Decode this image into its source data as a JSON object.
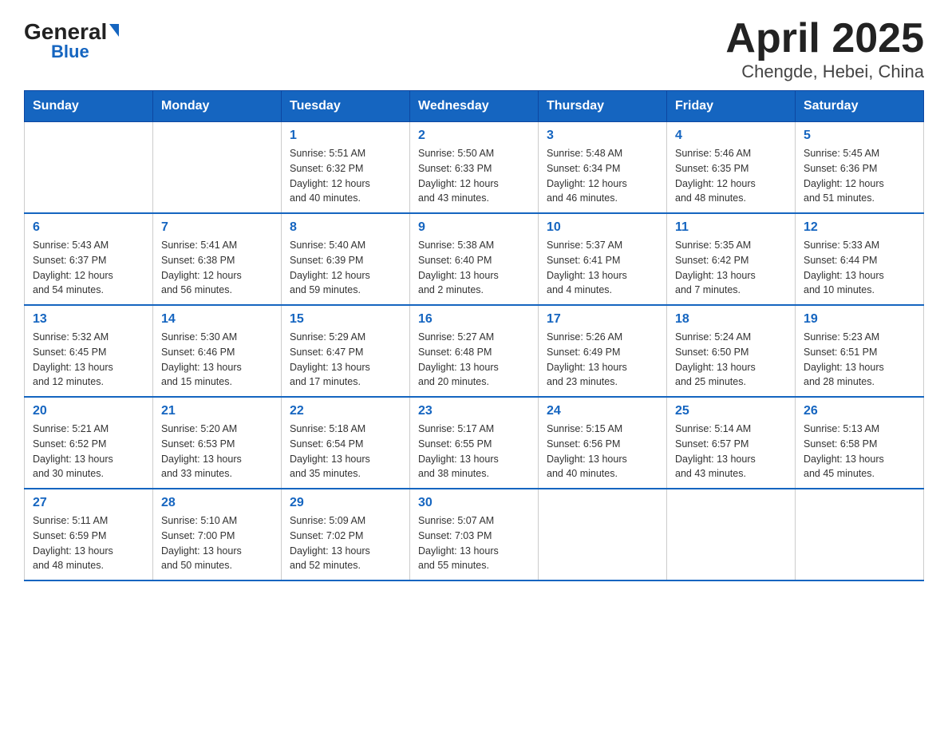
{
  "logo": {
    "general": "General",
    "blue": "Blue"
  },
  "title": "April 2025",
  "subtitle": "Chengde, Hebei, China",
  "days_of_week": [
    "Sunday",
    "Monday",
    "Tuesday",
    "Wednesday",
    "Thursday",
    "Friday",
    "Saturday"
  ],
  "weeks": [
    [
      {
        "day": "",
        "info": ""
      },
      {
        "day": "",
        "info": ""
      },
      {
        "day": "1",
        "info": "Sunrise: 5:51 AM\nSunset: 6:32 PM\nDaylight: 12 hours\nand 40 minutes."
      },
      {
        "day": "2",
        "info": "Sunrise: 5:50 AM\nSunset: 6:33 PM\nDaylight: 12 hours\nand 43 minutes."
      },
      {
        "day": "3",
        "info": "Sunrise: 5:48 AM\nSunset: 6:34 PM\nDaylight: 12 hours\nand 46 minutes."
      },
      {
        "day": "4",
        "info": "Sunrise: 5:46 AM\nSunset: 6:35 PM\nDaylight: 12 hours\nand 48 minutes."
      },
      {
        "day": "5",
        "info": "Sunrise: 5:45 AM\nSunset: 6:36 PM\nDaylight: 12 hours\nand 51 minutes."
      }
    ],
    [
      {
        "day": "6",
        "info": "Sunrise: 5:43 AM\nSunset: 6:37 PM\nDaylight: 12 hours\nand 54 minutes."
      },
      {
        "day": "7",
        "info": "Sunrise: 5:41 AM\nSunset: 6:38 PM\nDaylight: 12 hours\nand 56 minutes."
      },
      {
        "day": "8",
        "info": "Sunrise: 5:40 AM\nSunset: 6:39 PM\nDaylight: 12 hours\nand 59 minutes."
      },
      {
        "day": "9",
        "info": "Sunrise: 5:38 AM\nSunset: 6:40 PM\nDaylight: 13 hours\nand 2 minutes."
      },
      {
        "day": "10",
        "info": "Sunrise: 5:37 AM\nSunset: 6:41 PM\nDaylight: 13 hours\nand 4 minutes."
      },
      {
        "day": "11",
        "info": "Sunrise: 5:35 AM\nSunset: 6:42 PM\nDaylight: 13 hours\nand 7 minutes."
      },
      {
        "day": "12",
        "info": "Sunrise: 5:33 AM\nSunset: 6:44 PM\nDaylight: 13 hours\nand 10 minutes."
      }
    ],
    [
      {
        "day": "13",
        "info": "Sunrise: 5:32 AM\nSunset: 6:45 PM\nDaylight: 13 hours\nand 12 minutes."
      },
      {
        "day": "14",
        "info": "Sunrise: 5:30 AM\nSunset: 6:46 PM\nDaylight: 13 hours\nand 15 minutes."
      },
      {
        "day": "15",
        "info": "Sunrise: 5:29 AM\nSunset: 6:47 PM\nDaylight: 13 hours\nand 17 minutes."
      },
      {
        "day": "16",
        "info": "Sunrise: 5:27 AM\nSunset: 6:48 PM\nDaylight: 13 hours\nand 20 minutes."
      },
      {
        "day": "17",
        "info": "Sunrise: 5:26 AM\nSunset: 6:49 PM\nDaylight: 13 hours\nand 23 minutes."
      },
      {
        "day": "18",
        "info": "Sunrise: 5:24 AM\nSunset: 6:50 PM\nDaylight: 13 hours\nand 25 minutes."
      },
      {
        "day": "19",
        "info": "Sunrise: 5:23 AM\nSunset: 6:51 PM\nDaylight: 13 hours\nand 28 minutes."
      }
    ],
    [
      {
        "day": "20",
        "info": "Sunrise: 5:21 AM\nSunset: 6:52 PM\nDaylight: 13 hours\nand 30 minutes."
      },
      {
        "day": "21",
        "info": "Sunrise: 5:20 AM\nSunset: 6:53 PM\nDaylight: 13 hours\nand 33 minutes."
      },
      {
        "day": "22",
        "info": "Sunrise: 5:18 AM\nSunset: 6:54 PM\nDaylight: 13 hours\nand 35 minutes."
      },
      {
        "day": "23",
        "info": "Sunrise: 5:17 AM\nSunset: 6:55 PM\nDaylight: 13 hours\nand 38 minutes."
      },
      {
        "day": "24",
        "info": "Sunrise: 5:15 AM\nSunset: 6:56 PM\nDaylight: 13 hours\nand 40 minutes."
      },
      {
        "day": "25",
        "info": "Sunrise: 5:14 AM\nSunset: 6:57 PM\nDaylight: 13 hours\nand 43 minutes."
      },
      {
        "day": "26",
        "info": "Sunrise: 5:13 AM\nSunset: 6:58 PM\nDaylight: 13 hours\nand 45 minutes."
      }
    ],
    [
      {
        "day": "27",
        "info": "Sunrise: 5:11 AM\nSunset: 6:59 PM\nDaylight: 13 hours\nand 48 minutes."
      },
      {
        "day": "28",
        "info": "Sunrise: 5:10 AM\nSunset: 7:00 PM\nDaylight: 13 hours\nand 50 minutes."
      },
      {
        "day": "29",
        "info": "Sunrise: 5:09 AM\nSunset: 7:02 PM\nDaylight: 13 hours\nand 52 minutes."
      },
      {
        "day": "30",
        "info": "Sunrise: 5:07 AM\nSunset: 7:03 PM\nDaylight: 13 hours\nand 55 minutes."
      },
      {
        "day": "",
        "info": ""
      },
      {
        "day": "",
        "info": ""
      },
      {
        "day": "",
        "info": ""
      }
    ]
  ]
}
